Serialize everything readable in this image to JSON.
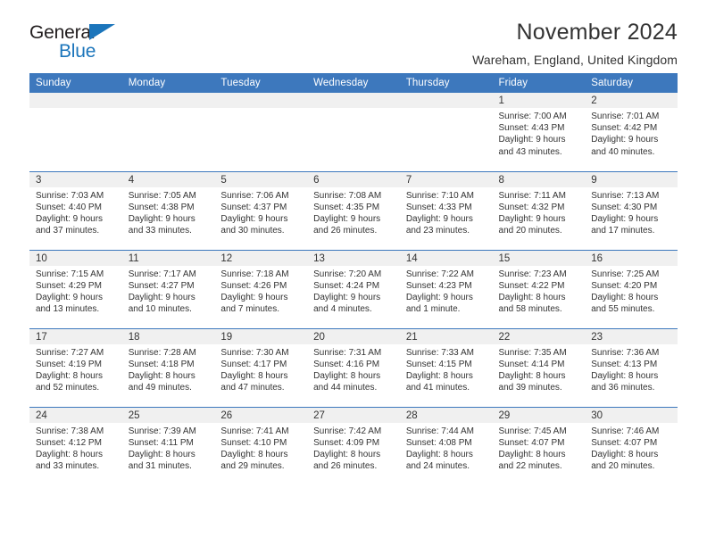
{
  "brand": {
    "name_top": "General",
    "name_bottom": "Blue",
    "accent_color": "#1b75bb"
  },
  "header": {
    "title": "November 2024",
    "location": "Wareham, England, United Kingdom"
  },
  "theme": {
    "header_blue": "#3d78bd",
    "daynum_band": "#f0f0f0",
    "text": "#333333"
  },
  "calendar": {
    "weekday_headers": [
      "Sunday",
      "Monday",
      "Tuesday",
      "Wednesday",
      "Thursday",
      "Friday",
      "Saturday"
    ],
    "weeks": [
      [
        {
          "day": "",
          "empty": true,
          "sunrise": "",
          "sunset": "",
          "daylight_1": "",
          "daylight_2": ""
        },
        {
          "day": "",
          "empty": true,
          "sunrise": "",
          "sunset": "",
          "daylight_1": "",
          "daylight_2": ""
        },
        {
          "day": "",
          "empty": true,
          "sunrise": "",
          "sunset": "",
          "daylight_1": "",
          "daylight_2": ""
        },
        {
          "day": "",
          "empty": true,
          "sunrise": "",
          "sunset": "",
          "daylight_1": "",
          "daylight_2": ""
        },
        {
          "day": "",
          "empty": true,
          "sunrise": "",
          "sunset": "",
          "daylight_1": "",
          "daylight_2": ""
        },
        {
          "day": "1",
          "sunrise": "Sunrise: 7:00 AM",
          "sunset": "Sunset: 4:43 PM",
          "daylight_1": "Daylight: 9 hours",
          "daylight_2": "and 43 minutes."
        },
        {
          "day": "2",
          "sunrise": "Sunrise: 7:01 AM",
          "sunset": "Sunset: 4:42 PM",
          "daylight_1": "Daylight: 9 hours",
          "daylight_2": "and 40 minutes."
        }
      ],
      [
        {
          "day": "3",
          "sunrise": "Sunrise: 7:03 AM",
          "sunset": "Sunset: 4:40 PM",
          "daylight_1": "Daylight: 9 hours",
          "daylight_2": "and 37 minutes."
        },
        {
          "day": "4",
          "sunrise": "Sunrise: 7:05 AM",
          "sunset": "Sunset: 4:38 PM",
          "daylight_1": "Daylight: 9 hours",
          "daylight_2": "and 33 minutes."
        },
        {
          "day": "5",
          "sunrise": "Sunrise: 7:06 AM",
          "sunset": "Sunset: 4:37 PM",
          "daylight_1": "Daylight: 9 hours",
          "daylight_2": "and 30 minutes."
        },
        {
          "day": "6",
          "sunrise": "Sunrise: 7:08 AM",
          "sunset": "Sunset: 4:35 PM",
          "daylight_1": "Daylight: 9 hours",
          "daylight_2": "and 26 minutes."
        },
        {
          "day": "7",
          "sunrise": "Sunrise: 7:10 AM",
          "sunset": "Sunset: 4:33 PM",
          "daylight_1": "Daylight: 9 hours",
          "daylight_2": "and 23 minutes."
        },
        {
          "day": "8",
          "sunrise": "Sunrise: 7:11 AM",
          "sunset": "Sunset: 4:32 PM",
          "daylight_1": "Daylight: 9 hours",
          "daylight_2": "and 20 minutes."
        },
        {
          "day": "9",
          "sunrise": "Sunrise: 7:13 AM",
          "sunset": "Sunset: 4:30 PM",
          "daylight_1": "Daylight: 9 hours",
          "daylight_2": "and 17 minutes."
        }
      ],
      [
        {
          "day": "10",
          "sunrise": "Sunrise: 7:15 AM",
          "sunset": "Sunset: 4:29 PM",
          "daylight_1": "Daylight: 9 hours",
          "daylight_2": "and 13 minutes."
        },
        {
          "day": "11",
          "sunrise": "Sunrise: 7:17 AM",
          "sunset": "Sunset: 4:27 PM",
          "daylight_1": "Daylight: 9 hours",
          "daylight_2": "and 10 minutes."
        },
        {
          "day": "12",
          "sunrise": "Sunrise: 7:18 AM",
          "sunset": "Sunset: 4:26 PM",
          "daylight_1": "Daylight: 9 hours",
          "daylight_2": "and 7 minutes."
        },
        {
          "day": "13",
          "sunrise": "Sunrise: 7:20 AM",
          "sunset": "Sunset: 4:24 PM",
          "daylight_1": "Daylight: 9 hours",
          "daylight_2": "and 4 minutes."
        },
        {
          "day": "14",
          "sunrise": "Sunrise: 7:22 AM",
          "sunset": "Sunset: 4:23 PM",
          "daylight_1": "Daylight: 9 hours",
          "daylight_2": "and 1 minute."
        },
        {
          "day": "15",
          "sunrise": "Sunrise: 7:23 AM",
          "sunset": "Sunset: 4:22 PM",
          "daylight_1": "Daylight: 8 hours",
          "daylight_2": "and 58 minutes."
        },
        {
          "day": "16",
          "sunrise": "Sunrise: 7:25 AM",
          "sunset": "Sunset: 4:20 PM",
          "daylight_1": "Daylight: 8 hours",
          "daylight_2": "and 55 minutes."
        }
      ],
      [
        {
          "day": "17",
          "sunrise": "Sunrise: 7:27 AM",
          "sunset": "Sunset: 4:19 PM",
          "daylight_1": "Daylight: 8 hours",
          "daylight_2": "and 52 minutes."
        },
        {
          "day": "18",
          "sunrise": "Sunrise: 7:28 AM",
          "sunset": "Sunset: 4:18 PM",
          "daylight_1": "Daylight: 8 hours",
          "daylight_2": "and 49 minutes."
        },
        {
          "day": "19",
          "sunrise": "Sunrise: 7:30 AM",
          "sunset": "Sunset: 4:17 PM",
          "daylight_1": "Daylight: 8 hours",
          "daylight_2": "and 47 minutes."
        },
        {
          "day": "20",
          "sunrise": "Sunrise: 7:31 AM",
          "sunset": "Sunset: 4:16 PM",
          "daylight_1": "Daylight: 8 hours",
          "daylight_2": "and 44 minutes."
        },
        {
          "day": "21",
          "sunrise": "Sunrise: 7:33 AM",
          "sunset": "Sunset: 4:15 PM",
          "daylight_1": "Daylight: 8 hours",
          "daylight_2": "and 41 minutes."
        },
        {
          "day": "22",
          "sunrise": "Sunrise: 7:35 AM",
          "sunset": "Sunset: 4:14 PM",
          "daylight_1": "Daylight: 8 hours",
          "daylight_2": "and 39 minutes."
        },
        {
          "day": "23",
          "sunrise": "Sunrise: 7:36 AM",
          "sunset": "Sunset: 4:13 PM",
          "daylight_1": "Daylight: 8 hours",
          "daylight_2": "and 36 minutes."
        }
      ],
      [
        {
          "day": "24",
          "sunrise": "Sunrise: 7:38 AM",
          "sunset": "Sunset: 4:12 PM",
          "daylight_1": "Daylight: 8 hours",
          "daylight_2": "and 33 minutes."
        },
        {
          "day": "25",
          "sunrise": "Sunrise: 7:39 AM",
          "sunset": "Sunset: 4:11 PM",
          "daylight_1": "Daylight: 8 hours",
          "daylight_2": "and 31 minutes."
        },
        {
          "day": "26",
          "sunrise": "Sunrise: 7:41 AM",
          "sunset": "Sunset: 4:10 PM",
          "daylight_1": "Daylight: 8 hours",
          "daylight_2": "and 29 minutes."
        },
        {
          "day": "27",
          "sunrise": "Sunrise: 7:42 AM",
          "sunset": "Sunset: 4:09 PM",
          "daylight_1": "Daylight: 8 hours",
          "daylight_2": "and 26 minutes."
        },
        {
          "day": "28",
          "sunrise": "Sunrise: 7:44 AM",
          "sunset": "Sunset: 4:08 PM",
          "daylight_1": "Daylight: 8 hours",
          "daylight_2": "and 24 minutes."
        },
        {
          "day": "29",
          "sunrise": "Sunrise: 7:45 AM",
          "sunset": "Sunset: 4:07 PM",
          "daylight_1": "Daylight: 8 hours",
          "daylight_2": "and 22 minutes."
        },
        {
          "day": "30",
          "sunrise": "Sunrise: 7:46 AM",
          "sunset": "Sunset: 4:07 PM",
          "daylight_1": "Daylight: 8 hours",
          "daylight_2": "and 20 minutes."
        }
      ]
    ]
  }
}
